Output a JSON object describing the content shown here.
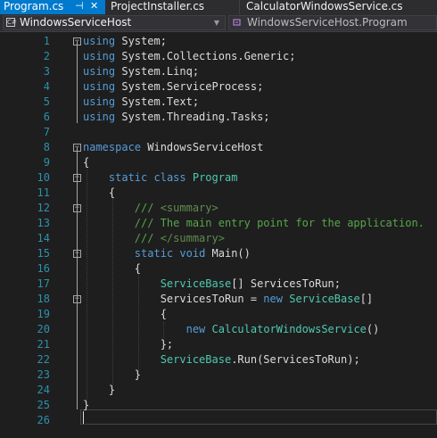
{
  "tabs": [
    {
      "label": "Program.cs",
      "active": true,
      "pinned": true,
      "pin_glyph": "⊣",
      "close_glyph": "✕"
    },
    {
      "label": "ProjectInstaller.cs",
      "active": false
    },
    {
      "label": "CalculatorWindowsService.cs",
      "active": false
    }
  ],
  "navbar": {
    "project_combo": {
      "value": "WindowsServiceHost",
      "icon": "class-icon",
      "icon_glyph": "C#"
    },
    "member_combo": {
      "value": "WindowsServiceHost.Program",
      "icon": "method-icon"
    },
    "dropdown_glyph": "▼"
  },
  "editor": {
    "current_line": 26,
    "lines": [
      {
        "n": "1",
        "code": "using System;",
        "fold": "−"
      },
      {
        "n": "2",
        "code": "using System.Collections.Generic;"
      },
      {
        "n": "3",
        "code": "using System.Linq;"
      },
      {
        "n": "4",
        "code": "using System.ServiceProcess;"
      },
      {
        "n": "5",
        "code": "using System.Text;"
      },
      {
        "n": "6",
        "code": "using System.Threading.Tasks;"
      },
      {
        "n": "7",
        "code": ""
      },
      {
        "n": "8",
        "code": "namespace WindowsServiceHost",
        "fold": "−"
      },
      {
        "n": "9",
        "code": "{"
      },
      {
        "n": "10",
        "code": "    static class Program",
        "fold": "−"
      },
      {
        "n": "11",
        "code": "    {"
      },
      {
        "n": "12",
        "code": "        /// <summary>",
        "fold": "−"
      },
      {
        "n": "13",
        "code": "        /// The main entry point for the application."
      },
      {
        "n": "14",
        "code": "        /// </summary>"
      },
      {
        "n": "15",
        "code": "        static void Main()",
        "fold": "−"
      },
      {
        "n": "16",
        "code": "        {"
      },
      {
        "n": "17",
        "code": "            ServiceBase[] ServicesToRun;"
      },
      {
        "n": "18",
        "code": "            ServicesToRun = new ServiceBase[]",
        "fold": "−"
      },
      {
        "n": "19",
        "code": "            {"
      },
      {
        "n": "20",
        "code": "                new CalculatorWindowsService()"
      },
      {
        "n": "21",
        "code": "            };"
      },
      {
        "n": "22",
        "code": "            ServiceBase.Run(ServicesToRun);"
      },
      {
        "n": "23",
        "code": "        }"
      },
      {
        "n": "24",
        "code": "    }"
      },
      {
        "n": "25",
        "code": "}"
      },
      {
        "n": "26",
        "code": ""
      }
    ]
  },
  "syntax_colors": {
    "keyword": "#569cd6",
    "type": "#4ec9b0",
    "comment": "#57a64a",
    "line_number": "#2b91af",
    "text": "#dcdcdc",
    "background": "#1e1e1e",
    "active_tab": "#007acc"
  }
}
